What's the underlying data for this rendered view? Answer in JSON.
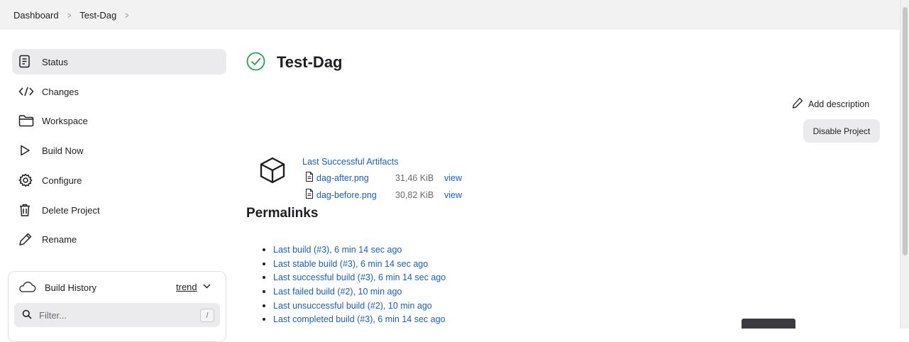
{
  "breadcrumb": {
    "items": [
      "Dashboard",
      "Test-Dag"
    ],
    "separator": ">"
  },
  "sidebar": {
    "items": [
      {
        "label": "Status",
        "icon": "document-icon",
        "active": true
      },
      {
        "label": "Changes",
        "icon": "code-icon"
      },
      {
        "label": "Workspace",
        "icon": "folder-icon"
      },
      {
        "label": "Build Now",
        "icon": "play-icon"
      },
      {
        "label": "Configure",
        "icon": "gear-icon"
      },
      {
        "label": "Delete Project",
        "icon": "trash-icon"
      },
      {
        "label": "Rename",
        "icon": "pencil-icon"
      }
    ],
    "build_history": {
      "title": "Build History",
      "trend_label": "trend",
      "filter_placeholder": "Filter...",
      "shortcut": "/"
    }
  },
  "main": {
    "title": "Test-Dag",
    "status_color": "#1ea64b",
    "add_description_label": "Add description",
    "disable_button_label": "Disable Project",
    "artifacts": {
      "title": "Last Successful Artifacts",
      "files": [
        {
          "name": "dag-after.png",
          "size": "31,46 KiB",
          "view": "view"
        },
        {
          "name": "dag-before.png",
          "size": "30,82 KiB",
          "view": "view"
        }
      ]
    },
    "permalinks": {
      "title": "Permalinks",
      "items": [
        "Last build (#3), 6 min 14 sec ago",
        "Last stable build (#3), 6 min 14 sec ago",
        "Last successful build (#3), 6 min 14 sec ago",
        "Last failed build (#2), 10 min ago",
        "Last unsuccessful build (#2), 10 min ago",
        "Last completed build (#3), 6 min 14 sec ago"
      ]
    }
  },
  "colors": {
    "link": "#1a5fc2",
    "breadcrumb_bg": "#f2f2f3",
    "active_item_bg": "#ebebed"
  }
}
